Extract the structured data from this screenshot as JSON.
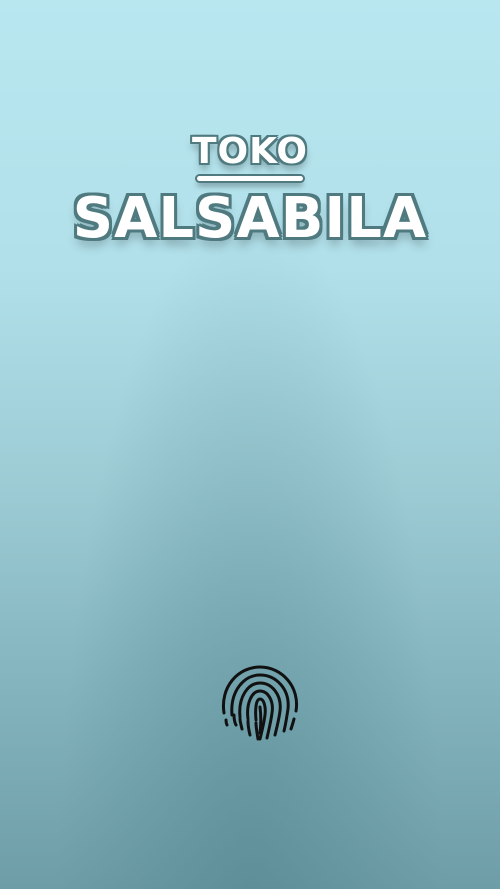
{
  "brand": {
    "top": "TOKO",
    "bottom": "SALSABILA"
  },
  "fingerprint": {
    "icon": "fingerprint-icon"
  },
  "colors": {
    "background_top": "#b9e7f0",
    "background_bottom": "#6e9da7",
    "text_fill": "#ffffff",
    "text_outline": "#4f7a80",
    "icon": "#111111"
  }
}
